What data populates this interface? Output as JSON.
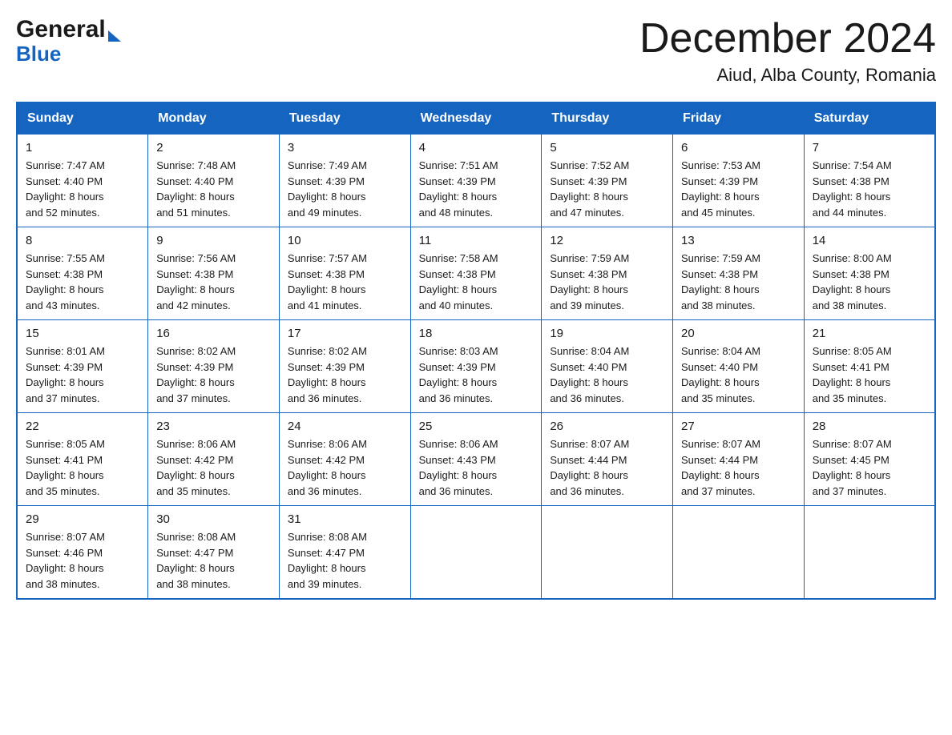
{
  "logo": {
    "general": "General",
    "blue": "Blue"
  },
  "title": {
    "month_year": "December 2024",
    "location": "Aiud, Alba County, Romania"
  },
  "days_header": [
    "Sunday",
    "Monday",
    "Tuesday",
    "Wednesday",
    "Thursday",
    "Friday",
    "Saturday"
  ],
  "weeks": [
    [
      {
        "day": "1",
        "sunrise": "Sunrise: 7:47 AM",
        "sunset": "Sunset: 4:40 PM",
        "daylight": "Daylight: 8 hours",
        "daylight2": "and 52 minutes."
      },
      {
        "day": "2",
        "sunrise": "Sunrise: 7:48 AM",
        "sunset": "Sunset: 4:40 PM",
        "daylight": "Daylight: 8 hours",
        "daylight2": "and 51 minutes."
      },
      {
        "day": "3",
        "sunrise": "Sunrise: 7:49 AM",
        "sunset": "Sunset: 4:39 PM",
        "daylight": "Daylight: 8 hours",
        "daylight2": "and 49 minutes."
      },
      {
        "day": "4",
        "sunrise": "Sunrise: 7:51 AM",
        "sunset": "Sunset: 4:39 PM",
        "daylight": "Daylight: 8 hours",
        "daylight2": "and 48 minutes."
      },
      {
        "day": "5",
        "sunrise": "Sunrise: 7:52 AM",
        "sunset": "Sunset: 4:39 PM",
        "daylight": "Daylight: 8 hours",
        "daylight2": "and 47 minutes."
      },
      {
        "day": "6",
        "sunrise": "Sunrise: 7:53 AM",
        "sunset": "Sunset: 4:39 PM",
        "daylight": "Daylight: 8 hours",
        "daylight2": "and 45 minutes."
      },
      {
        "day": "7",
        "sunrise": "Sunrise: 7:54 AM",
        "sunset": "Sunset: 4:38 PM",
        "daylight": "Daylight: 8 hours",
        "daylight2": "and 44 minutes."
      }
    ],
    [
      {
        "day": "8",
        "sunrise": "Sunrise: 7:55 AM",
        "sunset": "Sunset: 4:38 PM",
        "daylight": "Daylight: 8 hours",
        "daylight2": "and 43 minutes."
      },
      {
        "day": "9",
        "sunrise": "Sunrise: 7:56 AM",
        "sunset": "Sunset: 4:38 PM",
        "daylight": "Daylight: 8 hours",
        "daylight2": "and 42 minutes."
      },
      {
        "day": "10",
        "sunrise": "Sunrise: 7:57 AM",
        "sunset": "Sunset: 4:38 PM",
        "daylight": "Daylight: 8 hours",
        "daylight2": "and 41 minutes."
      },
      {
        "day": "11",
        "sunrise": "Sunrise: 7:58 AM",
        "sunset": "Sunset: 4:38 PM",
        "daylight": "Daylight: 8 hours",
        "daylight2": "and 40 minutes."
      },
      {
        "day": "12",
        "sunrise": "Sunrise: 7:59 AM",
        "sunset": "Sunset: 4:38 PM",
        "daylight": "Daylight: 8 hours",
        "daylight2": "and 39 minutes."
      },
      {
        "day": "13",
        "sunrise": "Sunrise: 7:59 AM",
        "sunset": "Sunset: 4:38 PM",
        "daylight": "Daylight: 8 hours",
        "daylight2": "and 38 minutes."
      },
      {
        "day": "14",
        "sunrise": "Sunrise: 8:00 AM",
        "sunset": "Sunset: 4:38 PM",
        "daylight": "Daylight: 8 hours",
        "daylight2": "and 38 minutes."
      }
    ],
    [
      {
        "day": "15",
        "sunrise": "Sunrise: 8:01 AM",
        "sunset": "Sunset: 4:39 PM",
        "daylight": "Daylight: 8 hours",
        "daylight2": "and 37 minutes."
      },
      {
        "day": "16",
        "sunrise": "Sunrise: 8:02 AM",
        "sunset": "Sunset: 4:39 PM",
        "daylight": "Daylight: 8 hours",
        "daylight2": "and 37 minutes."
      },
      {
        "day": "17",
        "sunrise": "Sunrise: 8:02 AM",
        "sunset": "Sunset: 4:39 PM",
        "daylight": "Daylight: 8 hours",
        "daylight2": "and 36 minutes."
      },
      {
        "day": "18",
        "sunrise": "Sunrise: 8:03 AM",
        "sunset": "Sunset: 4:39 PM",
        "daylight": "Daylight: 8 hours",
        "daylight2": "and 36 minutes."
      },
      {
        "day": "19",
        "sunrise": "Sunrise: 8:04 AM",
        "sunset": "Sunset: 4:40 PM",
        "daylight": "Daylight: 8 hours",
        "daylight2": "and 36 minutes."
      },
      {
        "day": "20",
        "sunrise": "Sunrise: 8:04 AM",
        "sunset": "Sunset: 4:40 PM",
        "daylight": "Daylight: 8 hours",
        "daylight2": "and 35 minutes."
      },
      {
        "day": "21",
        "sunrise": "Sunrise: 8:05 AM",
        "sunset": "Sunset: 4:41 PM",
        "daylight": "Daylight: 8 hours",
        "daylight2": "and 35 minutes."
      }
    ],
    [
      {
        "day": "22",
        "sunrise": "Sunrise: 8:05 AM",
        "sunset": "Sunset: 4:41 PM",
        "daylight": "Daylight: 8 hours",
        "daylight2": "and 35 minutes."
      },
      {
        "day": "23",
        "sunrise": "Sunrise: 8:06 AM",
        "sunset": "Sunset: 4:42 PM",
        "daylight": "Daylight: 8 hours",
        "daylight2": "and 35 minutes."
      },
      {
        "day": "24",
        "sunrise": "Sunrise: 8:06 AM",
        "sunset": "Sunset: 4:42 PM",
        "daylight": "Daylight: 8 hours",
        "daylight2": "and 36 minutes."
      },
      {
        "day": "25",
        "sunrise": "Sunrise: 8:06 AM",
        "sunset": "Sunset: 4:43 PM",
        "daylight": "Daylight: 8 hours",
        "daylight2": "and 36 minutes."
      },
      {
        "day": "26",
        "sunrise": "Sunrise: 8:07 AM",
        "sunset": "Sunset: 4:44 PM",
        "daylight": "Daylight: 8 hours",
        "daylight2": "and 36 minutes."
      },
      {
        "day": "27",
        "sunrise": "Sunrise: 8:07 AM",
        "sunset": "Sunset: 4:44 PM",
        "daylight": "Daylight: 8 hours",
        "daylight2": "and 37 minutes."
      },
      {
        "day": "28",
        "sunrise": "Sunrise: 8:07 AM",
        "sunset": "Sunset: 4:45 PM",
        "daylight": "Daylight: 8 hours",
        "daylight2": "and 37 minutes."
      }
    ],
    [
      {
        "day": "29",
        "sunrise": "Sunrise: 8:07 AM",
        "sunset": "Sunset: 4:46 PM",
        "daylight": "Daylight: 8 hours",
        "daylight2": "and 38 minutes."
      },
      {
        "day": "30",
        "sunrise": "Sunrise: 8:08 AM",
        "sunset": "Sunset: 4:47 PM",
        "daylight": "Daylight: 8 hours",
        "daylight2": "and 38 minutes."
      },
      {
        "day": "31",
        "sunrise": "Sunrise: 8:08 AM",
        "sunset": "Sunset: 4:47 PM",
        "daylight": "Daylight: 8 hours",
        "daylight2": "and 39 minutes."
      },
      null,
      null,
      null,
      null
    ]
  ]
}
